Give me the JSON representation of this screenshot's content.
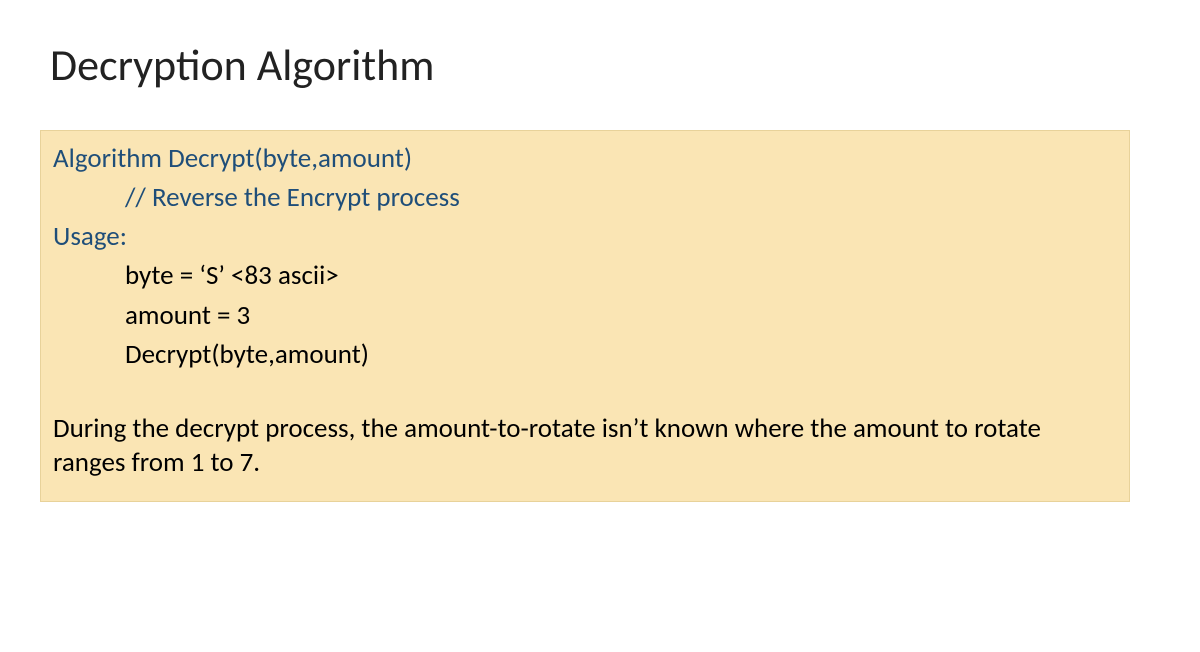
{
  "title": "Decryption Algorithm",
  "box": {
    "line1": "Algorithm Decrypt(byte,amount)",
    "line2": "// Reverse the Encrypt process",
    "line3": "Usage:",
    "line4": "byte = ‘S’ <83 ascii>",
    "line5": "amount = 3",
    "line6": "Decrypt(byte,amount)",
    "para": "During the decrypt process, the amount-to-rotate isn’t known where the amount to rotate ranges from 1 to 7."
  }
}
